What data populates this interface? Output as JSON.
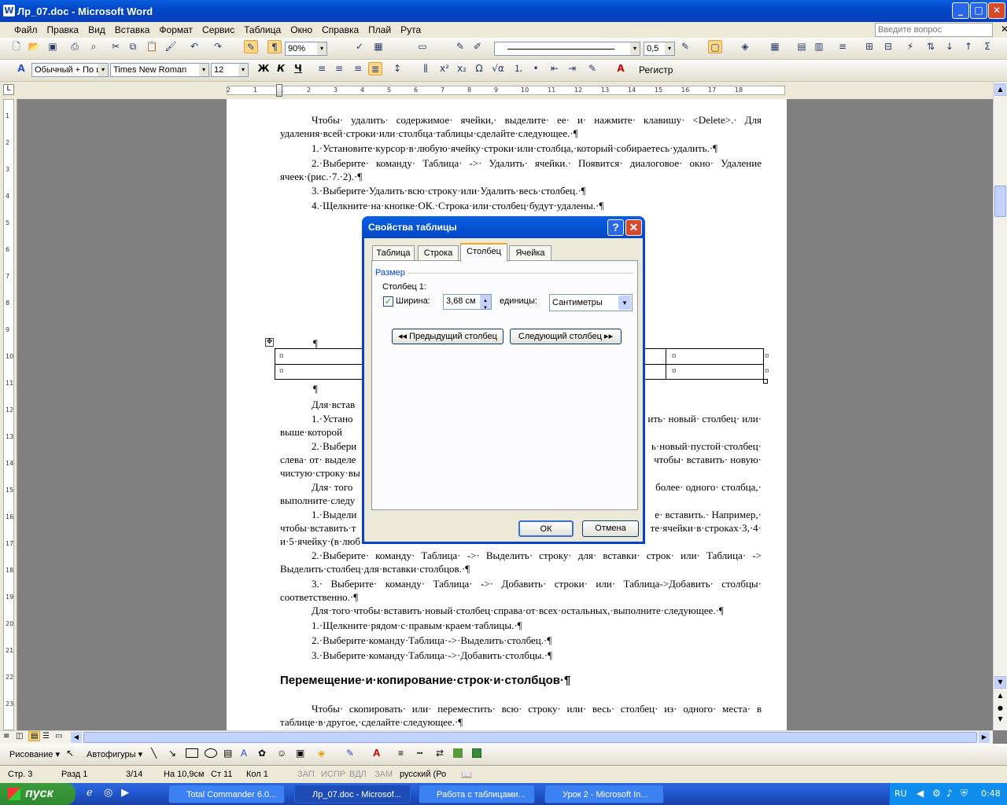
{
  "window": {
    "title": "Лр_07.doc - Microsoft Word",
    "minimize": "_",
    "maximize": "□",
    "close": "✕"
  },
  "menu": [
    "Файл",
    "Правка",
    "Вид",
    "Вставка",
    "Формат",
    "Сервис",
    "Таблица",
    "Окно",
    "Справка",
    "Плай",
    "Рута"
  ],
  "help_box": {
    "placeholder": "Введите вопрос"
  },
  "toolbar1": {
    "zoom": "90%",
    "line_weight": "0,5"
  },
  "toolbar2": {
    "style": "Обычный + По ц",
    "font": "Times New Roman",
    "size": "12",
    "bold": "Ж",
    "italic": "К",
    "underline": "Ч",
    "register": "Регистр"
  },
  "ruler": {
    "marks": [
      "2",
      "1",
      "1",
      "2",
      "3",
      "4",
      "5",
      "6",
      "7",
      "8",
      "9",
      "10",
      "11",
      "12",
      "13",
      "14",
      "15",
      "16",
      "17",
      "18"
    ]
  },
  "document": {
    "paragraphs": [
      "Чтобы· удалить· содержимое· ячейки,· выделите· ее· и· нажмите· клавишу· <Delete>.· Для удаления·всей·строки·или·столбца·таблицы·сделайте·следующее.·¶",
      "1.·Установите·курсор·в·любую·ячейку·строки·или·столбца,·который·собираетесь·удалить.·¶",
      "2.·Выберите· команду· Таблица· ->· Удалить· ячейки.· Появится· диалоговое· окно· Удаление ячеек·(рис.·7.·2).·¶",
      "3.·Выберите·Удалить·всю·строку·или·Удалить·весь·столбец.·¶",
      "4.·Щелкните·на·кнопке·ОК.·Строка·или·столбец·будут·удалены.·¶"
    ],
    "pilcrow": "¶",
    "cell_mark": "¤",
    "p_insert": "Для·встав",
    "p_a1": "1.·Устано",
    "p_a1_end": "ить· новый· столбец· или·",
    "p_a1b": "выше·которой",
    "p_a2": "2.·Выбери",
    "p_a2_end": "ь·новый·пустой·столбец·",
    "p_a2b": "слева· от· выделе",
    "p_a2b_end": "чтобы· вставить· новую·",
    "p_a2c": "чистую·строку·вы",
    "p_a3": "Для· того",
    "p_a3_end": "более· одного· столбца,·",
    "p_a3b": "выполните·следу",
    "p_a4": "1.·Выдели",
    "p_a4_end": "е· вставить.· Например,·",
    "p_a4b": "чтобы·вставить·т",
    "p_a4b_end": "те·ячейки·в·строках·3,·4·",
    "p_a4c": "и·5·ячейку·(в·люб",
    "after": [
      "2.·Выберите· команду· Таблица· ->· Выделить· строку· для· вставки· строк· или· Таблица· -> Выделить·столбец·для·вставки·столбцов.·¶",
      "3.· Выберите· команду· Таблица· ->· Добавить· строки· или· Таблица->Добавить· столбцы· соответственно.·¶",
      "Для·того·чтобы·вставить·новый·столбец·справа·от·всех·остальных,·выполните·следующее.·¶",
      "1.·Щелкните·рядом·с·правым·краем·таблицы.·¶",
      "2.·Выберите·команду·Таблица·->·Выделить·столбец.·¶",
      "3.·Выберите·команду·Таблица·->·Добавить·столбцы.·¶"
    ],
    "heading": "Перемещение·и·копирование·строк·и·столбцов·¶",
    "last": "Чтобы· скопировать· или· переместить· всю· строку· или· весь· столбец· из· одного· места· в таблице·в·другое,·сделайте·следующее.·¶"
  },
  "dialog": {
    "title": "Свойства таблицы",
    "help": "?",
    "close": "✕",
    "tabs": [
      "Таблица",
      "Строка",
      "Столбец",
      "Ячейка"
    ],
    "group": "Размер",
    "column_label": "Столбец 1:",
    "width_label": "Ширина:",
    "width_value": "3,68 см",
    "units_label": "единицы:",
    "units_value": "Сантиметры",
    "prev_button": "◂◂ Предыдущий столбец",
    "next_button": "Следующий столбец ▸▸",
    "ok": "ОК",
    "cancel": "Отмена"
  },
  "drawbar": {
    "draw": "Рисование ▾",
    "autoshapes": "Автофигуры ▾"
  },
  "status": {
    "page": "Стр. 3",
    "section": "Разд 1",
    "pages": "3/14",
    "at": "На 10,9см",
    "line": "Ст 11",
    "col": "Кол 1",
    "rec": "ЗАП",
    "trk": "ИСПР",
    "ext": "ВДЛ",
    "ovr": "ЗАМ",
    "lang": "русский (Ро"
  },
  "taskbar": {
    "start": "пуск",
    "tasks": [
      "Total Commander 6.0...",
      "Лр_07.doc - Microsof...",
      "Работа с таблицами...",
      "Урок 2 - Microsoft In..."
    ],
    "lang": "RU",
    "time": "0:48"
  }
}
